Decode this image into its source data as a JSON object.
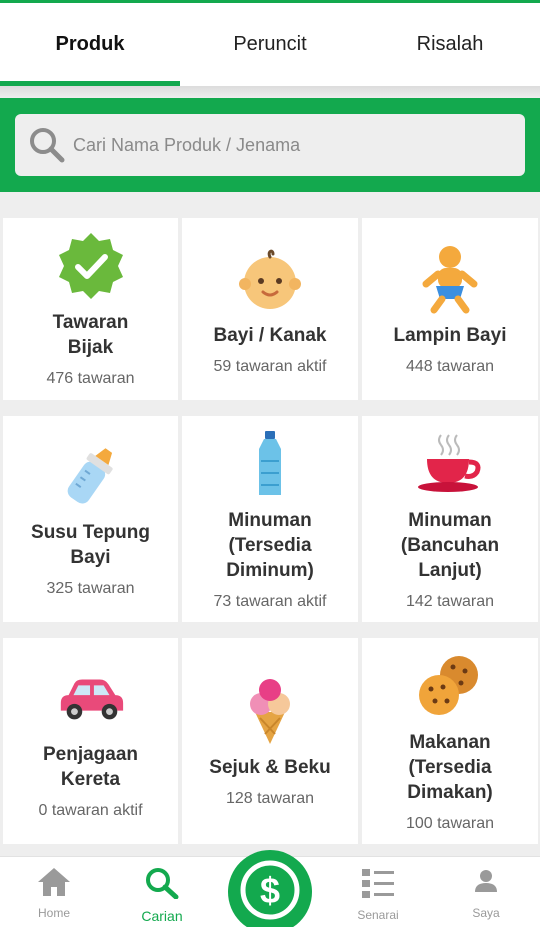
{
  "tabs": [
    {
      "label": "Produk",
      "active": true
    },
    {
      "label": "Peruncit",
      "active": false
    },
    {
      "label": "Risalah",
      "active": false
    }
  ],
  "search": {
    "placeholder": "Cari Nama Produk / Jenama",
    "icon": "search-icon"
  },
  "categories": [
    {
      "name": "Tawaran Bijak",
      "count": "476 tawaran",
      "icon": "verified-badge-icon"
    },
    {
      "name": "Bayi / Kanak",
      "count": "59 tawaran aktif",
      "icon": "baby-face-icon"
    },
    {
      "name": "Lampin Bayi",
      "count": "448 tawaran",
      "icon": "baby-diaper-icon"
    },
    {
      "name": "Susu Tepung Bayi",
      "count": "325 tawaran",
      "icon": "baby-bottle-icon"
    },
    {
      "name": "Minuman (Tersedia Diminum)",
      "count": "73 tawaran aktif",
      "icon": "water-bottle-icon"
    },
    {
      "name": "Minuman (Bancuhan Lanjut)",
      "count": "142 tawaran",
      "icon": "coffee-cup-icon"
    },
    {
      "name": "Penjagaan Kereta",
      "count": "0 tawaran aktif",
      "icon": "car-icon"
    },
    {
      "name": "Sejuk & Beku",
      "count": "128 tawaran",
      "icon": "ice-cream-icon"
    },
    {
      "name": "Makanan (Tersedia Dimakan)",
      "count": "100 tawaran",
      "icon": "cookie-icon"
    }
  ],
  "bottom_nav": [
    {
      "label": "Home",
      "icon": "home-icon",
      "active": false
    },
    {
      "label": "Carian",
      "icon": "search-icon",
      "active": true
    },
    {
      "label": "Senarai",
      "icon": "list-icon",
      "active": false
    },
    {
      "label": "Saya",
      "icon": "person-icon",
      "active": false
    }
  ],
  "fab": {
    "icon": "dollar-icon",
    "symbol": "$"
  },
  "colors": {
    "accent": "#13a94e",
    "background": "#eeeeee"
  }
}
